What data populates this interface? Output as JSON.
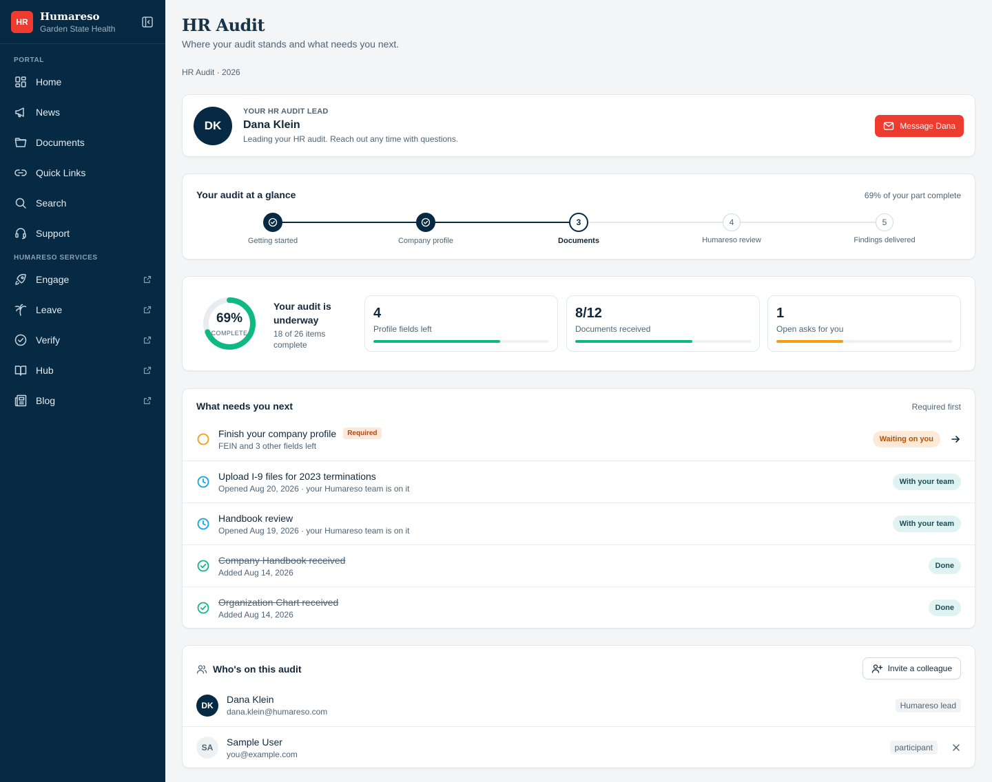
{
  "brand": {
    "logo": "HR",
    "name": "Humareso",
    "subtitle": "Garden State Health"
  },
  "sidebar": {
    "section_portal": "PORTAL",
    "portal_items": [
      {
        "label": "Home",
        "icon": "grid-icon"
      },
      {
        "label": "News",
        "icon": "megaphone-icon"
      },
      {
        "label": "Documents",
        "icon": "folder-icon"
      },
      {
        "label": "Quick Links",
        "icon": "link-icon"
      },
      {
        "label": "Search",
        "icon": "search-icon"
      },
      {
        "label": "Support",
        "icon": "headset-icon"
      }
    ],
    "section_services": "HUMARESO SERVICES",
    "service_items": [
      {
        "label": "Engage",
        "icon": "rocket-icon"
      },
      {
        "label": "Leave",
        "icon": "palm-tree-icon"
      },
      {
        "label": "Verify",
        "icon": "check-badge-icon"
      },
      {
        "label": "Hub",
        "icon": "book-icon"
      },
      {
        "label": "Blog",
        "icon": "newspaper-icon"
      }
    ]
  },
  "page": {
    "title": "HR Audit",
    "subtitle": "Where your audit stands and what needs you next.",
    "breadcrumb": "HR Audit · 2026"
  },
  "lead": {
    "initials": "DK",
    "kicker": "YOUR HR AUDIT LEAD",
    "name": "Dana Klein",
    "description": "Leading your HR audit. Reach out any time with questions.",
    "button": "Message Dana"
  },
  "glance": {
    "title": "Your audit at a glance",
    "meta": "69% of your part complete",
    "steps": [
      {
        "label": "Getting started",
        "state": "done",
        "number": "1"
      },
      {
        "label": "Company profile",
        "state": "done",
        "number": "2"
      },
      {
        "label": "Documents",
        "state": "current",
        "number": "3"
      },
      {
        "label": "Humareso review",
        "state": "todo",
        "number": "4"
      },
      {
        "label": "Findings delivered",
        "state": "todo",
        "number": "5"
      }
    ]
  },
  "progress": {
    "percent": 69,
    "percent_label": "69%",
    "ring_sub": "COMPLETE",
    "status_title": "Your audit is underway",
    "status_detail": "18 of 26 items complete",
    "stats": [
      {
        "value": "4",
        "label": "Profile fields left",
        "fill": 0.72,
        "color": "#10b981"
      },
      {
        "value": "8/12",
        "label": "Documents received",
        "fill": 0.667,
        "color": "#10b981"
      },
      {
        "value": "1",
        "label": "Open asks for you",
        "fill": 0.38,
        "color": "#f59e0b"
      }
    ]
  },
  "tasks": {
    "title": "What needs you next",
    "meta": "Required first",
    "items": [
      {
        "title": "Finish your company profile",
        "badge": "Required",
        "subtitle": "FEIN and 3 other fields left",
        "status": "Waiting on you",
        "kind": "open"
      },
      {
        "title": "Upload I-9 files for 2023 terminations",
        "subtitle": "Opened Aug 20, 2026 · your Humareso team is on it",
        "status": "With your team",
        "kind": "team"
      },
      {
        "title": "Handbook review",
        "subtitle": "Opened Aug 19, 2026 · your Humareso team is on it",
        "status": "With your team",
        "kind": "team"
      },
      {
        "title": "Company Handbook received",
        "subtitle": "Added Aug 14, 2026",
        "status": "Done",
        "kind": "done"
      },
      {
        "title": "Organization Chart received",
        "subtitle": "Added Aug 14, 2026",
        "status": "Done",
        "kind": "done"
      }
    ]
  },
  "people": {
    "title": "Who's on this audit",
    "invite_button": "Invite a colleague",
    "members": [
      {
        "initials": "DK",
        "name": "Dana Klein",
        "email": "dana.klein@humareso.com",
        "role": "Humareso lead"
      },
      {
        "initials": "SA",
        "name": "Sample User",
        "email": "you@example.com",
        "role": "participant"
      }
    ]
  },
  "colors": {
    "navy": "#062a43",
    "accent_red": "#ee3b2f",
    "success": "#10b981",
    "warning": "#f59e0b",
    "info": "#0ea5e9"
  }
}
